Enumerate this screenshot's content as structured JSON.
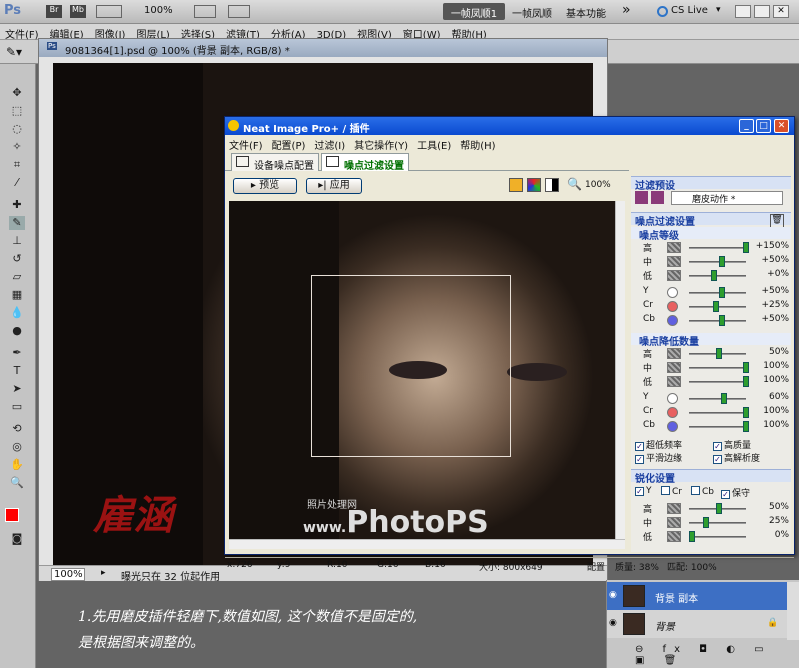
{
  "app": {
    "logo": "Ps",
    "zoom": "100%",
    "workspace_active": "一帧凤顺1",
    "workspace_2": "一帧凤顺",
    "workspace_3": "基本功能",
    "overflow": "»",
    "cslive": "CS Live",
    "cslive_dropdown": "▾"
  },
  "menu": [
    "文件(F)",
    "编辑(E)",
    "图像(I)",
    "图层(L)",
    "选择(S)",
    "滤镜(T)",
    "分析(A)",
    "3D(D)",
    "视图(V)",
    "窗口(W)",
    "帮助(H)"
  ],
  "document": {
    "tab_logo": "Ps",
    "title": "9081364[1].psd @ 100% (背景 副本, RGB/8) *",
    "zoom": "100%",
    "status": "曝光只在 32 位起作用",
    "watermark": "雇涵"
  },
  "neat": {
    "title": "Neat Image Pro+ / 插件",
    "menu": [
      "文件(F)",
      "配置(P)",
      "过滤(I)",
      "其它操作(Y)",
      "工具(E)",
      "帮助(H)"
    ],
    "tab1": "设备噪点配置",
    "tab2": "噪点过滤设置",
    "preview_btn": "预览",
    "apply_btn": "应用",
    "zoom": "100%",
    "watermark_small": "照片处理网",
    "watermark_url_prefix": "www.",
    "watermark_url_brand": "PhotoPS",
    ".com": ".com",
    "status": {
      "x": "x:726",
      "y": "y:9",
      "r": "R:10",
      "g": "G:16",
      "b": "B:16",
      "size": "大小: 800x649",
      "config": "配置",
      "quality": "质量: 38%",
      "match": "匹配: 100%"
    },
    "presets_header": "过滤预设",
    "preset_value": "磨皮动作 *",
    "filter_header": "噪点过滤设置",
    "noise_level_header": "噪点等级",
    "noise_level": [
      {
        "label": "高",
        "value": "+150%",
        "level": 1.0
      },
      {
        "label": "中",
        "value": "+50%",
        "level": 0.55
      },
      {
        "label": "低",
        "value": "+0%",
        "level": 0.4
      }
    ],
    "noise_level_channels": [
      {
        "label": "Y",
        "value": "+50%",
        "level": 0.55,
        "color": "#ffffff"
      },
      {
        "label": "Cr",
        "value": "+25%",
        "level": 0.45,
        "color": "#e86060"
      },
      {
        "label": "Cb",
        "value": "+50%",
        "level": 0.55,
        "color": "#6060e0"
      }
    ],
    "reduction_header": "噪点降低数量",
    "reduction": [
      {
        "label": "高",
        "value": "50%",
        "level": 0.5
      },
      {
        "label": "中",
        "value": "100%",
        "level": 1.0
      },
      {
        "label": "低",
        "value": "100%",
        "level": 1.0
      }
    ],
    "reduction_channels": [
      {
        "label": "Y",
        "value": "60%",
        "level": 0.6,
        "color": "#ffffff"
      },
      {
        "label": "Cr",
        "value": "100%",
        "level": 1.0,
        "color": "#e86060"
      },
      {
        "label": "Cb",
        "value": "100%",
        "level": 1.0,
        "color": "#6060e0"
      }
    ],
    "checks": [
      {
        "label": "超低频率",
        "checked": true
      },
      {
        "label": "高质量",
        "checked": true
      },
      {
        "label": "平滑边缘",
        "checked": true
      },
      {
        "label": "高解析度",
        "checked": true
      }
    ],
    "sharpen_header": "锐化设置",
    "sharpen_checks": [
      {
        "label": "Y",
        "checked": true
      },
      {
        "label": "Cr",
        "checked": false
      },
      {
        "label": "Cb",
        "checked": false
      },
      {
        "label": "保守",
        "checked": true
      }
    ],
    "sharpen": [
      {
        "label": "高",
        "value": "50%",
        "level": 0.5
      },
      {
        "label": "中",
        "value": "25%",
        "level": 0.25
      },
      {
        "label": "低",
        "value": "0%",
        "level": 0.0
      }
    ]
  },
  "layers": [
    {
      "name": "背景 副本",
      "selected": true
    },
    {
      "name": "背景",
      "selected": false
    }
  ],
  "caption": {
    "line1": "1.先用磨皮插件轻磨下,数值如图, 这个数值不是固定的,",
    "line2": "是根据图来调整的。"
  },
  "colors": {
    "accent": "#316ac5",
    "foreground": "#ff0000",
    "xp_title": "#0a4ad0"
  }
}
